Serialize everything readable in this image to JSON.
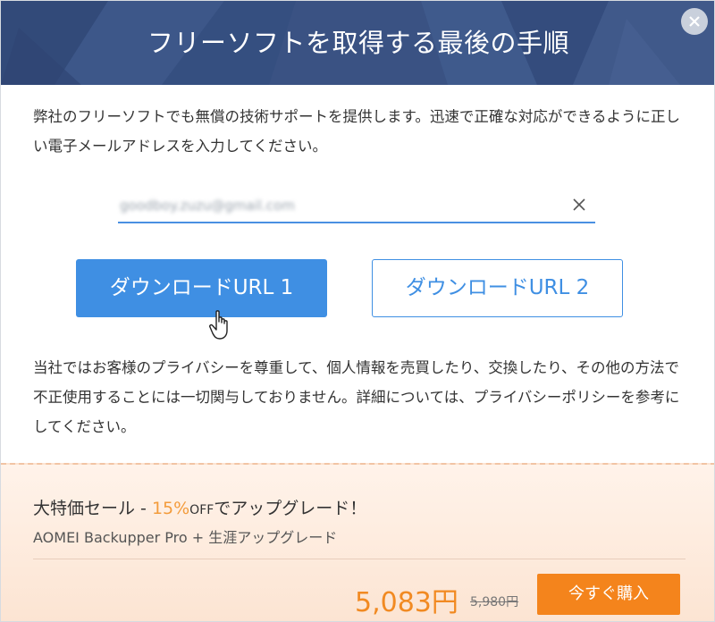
{
  "dialog": {
    "title": "フリーソフトを取得する最後の手順",
    "intro": "弊社のフリーソフトでも無償の技術サポートを提供します。迅速で正確な対応ができるように正しい電子メールアドレスを入力してください。",
    "email": {
      "value": "goodboy.zuzu@gmail.com",
      "clear_icon": "close-icon"
    },
    "buttons": {
      "download1": "ダウンロードURL 1",
      "download2": "ダウンロードURL 2"
    },
    "privacy": "当社ではお客様のプライバシーを尊重して、個人情報を売買したり、交換したり、その他の方法で不正使用することには一切関与しておりません。詳細については、プライバシーポリシーを参考にしてください。"
  },
  "promo": {
    "title_prefix": "大特価セール - ",
    "discount": "15%",
    "off": "OFF",
    "title_suffix": "でアップグレード！",
    "subtitle": "AOMEI Backupper Pro + 生涯アップグレード",
    "price": "5,083円",
    "old_price": "5,980円",
    "buy_label": "今すぐ購入"
  },
  "colors": {
    "header": "#3a5283",
    "primary": "#3f8fe3",
    "accent": "#f18a22",
    "promo_bg": "#fdebdd"
  }
}
